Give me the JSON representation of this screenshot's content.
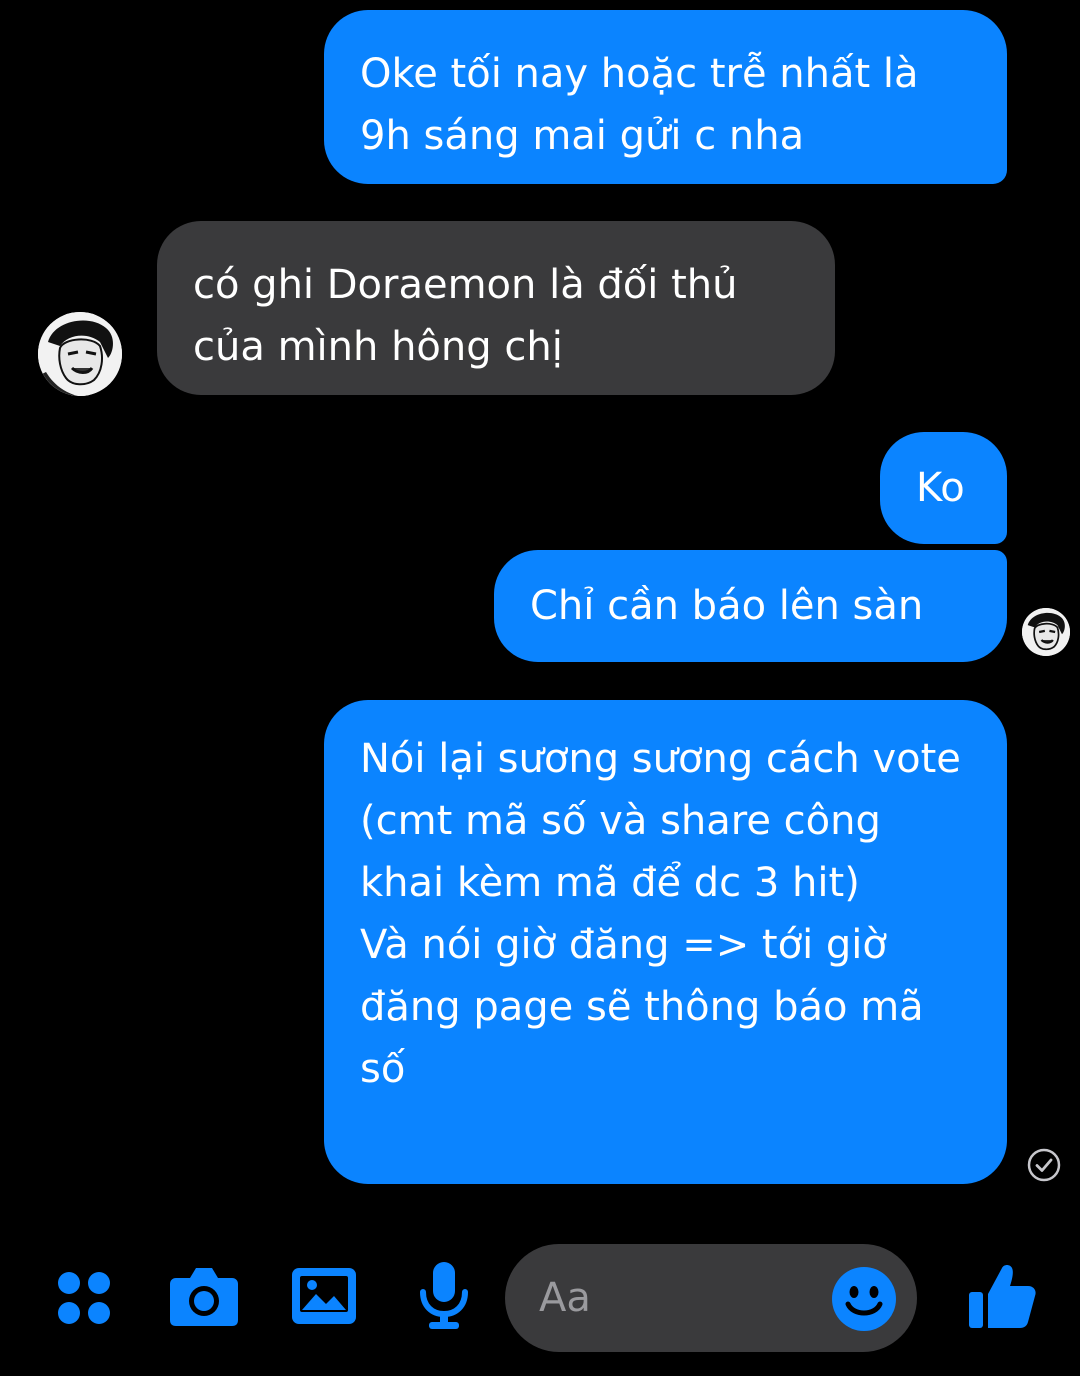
{
  "messages": [
    {
      "id": "msg1",
      "direction": "outgoing",
      "text": "Oke tối nay hoặc trễ nhất là 9h sáng mai gửi c nha"
    },
    {
      "id": "msg2",
      "direction": "incoming",
      "text": "có ghi Doraemon là đối thủ của mình hông chị"
    },
    {
      "id": "msg3",
      "direction": "outgoing",
      "text": "Ko"
    },
    {
      "id": "msg4",
      "direction": "outgoing",
      "text": "Chỉ cần báo lên sàn"
    },
    {
      "id": "msg5",
      "direction": "outgoing",
      "lines": [
        "Nói lại sương sương cách vote (cmt mã số và share công khai kèm mã để dc 3 hit)",
        "Và nói giờ đăng => tới giờ đăng page sẽ thông báo mã số"
      ]
    }
  ],
  "composer": {
    "placeholder": "Aa",
    "icons": [
      "apps-grid-icon",
      "camera-icon",
      "gallery-icon",
      "microphone-icon",
      "emoji-icon",
      "thumbs-up-icon"
    ]
  },
  "status": {
    "icon": "seen-check-icon"
  },
  "colors": {
    "outgoing_bubble": "#0b84ff",
    "incoming_bubble": "#3a3a3c",
    "background": "#000000",
    "accent": "#0b84ff",
    "placeholder_text": "#9a9a9e"
  }
}
